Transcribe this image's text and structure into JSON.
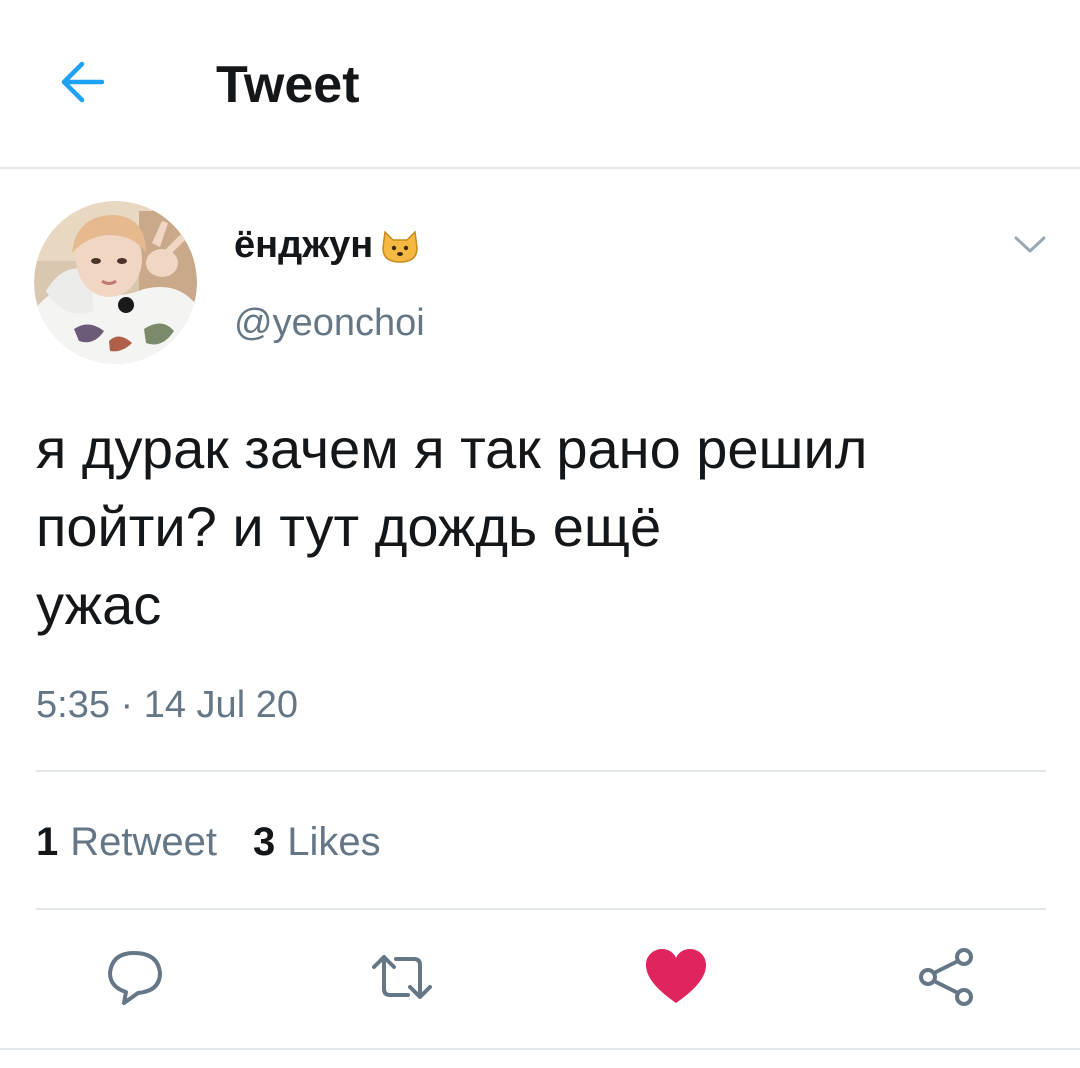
{
  "header": {
    "title": "Tweet",
    "back_icon": "arrow-left-icon"
  },
  "tweet": {
    "author": {
      "display_name": "ёнджун",
      "emoji_icon": "cat-face-icon",
      "handle": "@yeonchoi"
    },
    "text_lines": [
      "я дурак зачем я так рано решил",
      "пойти? и тут дождь ещё",
      "ужас"
    ],
    "timestamp": "5:35 · 14 Jul 20"
  },
  "stats": {
    "retweets": {
      "count": "1",
      "label": "Retweet"
    },
    "likes": {
      "count": "3",
      "label": "Likes"
    }
  },
  "actions": {
    "reply_icon": "reply-icon",
    "retweet_icon": "retweet-icon",
    "like_icon": "heart-icon",
    "share_icon": "share-icon"
  },
  "colors": {
    "accent": "#1da1f2",
    "like": "#e0245e",
    "secondary_text": "#657786",
    "divider": "#e1e8ed"
  }
}
